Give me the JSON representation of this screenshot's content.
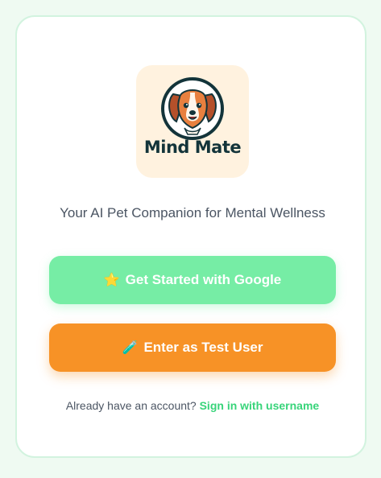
{
  "logo": {
    "icon": "dog-face-icon",
    "text": "Mind Mate"
  },
  "tagline": "Your AI Pet Companion for Mental Wellness",
  "buttons": {
    "google": {
      "icon": "⭐",
      "label": "Get Started with Google"
    },
    "test_user": {
      "icon": "🧪",
      "label": "Enter as Test User"
    }
  },
  "footer": {
    "prompt": "Already have an account?",
    "link": "Sign in with username"
  },
  "colors": {
    "background": "#effaf2",
    "card_border": "#d2f3df",
    "logo_tile": "#fff2df",
    "google_button": "#76eda5",
    "test_button": "#f79226",
    "link": "#38d47a",
    "text": "#4b5563"
  }
}
